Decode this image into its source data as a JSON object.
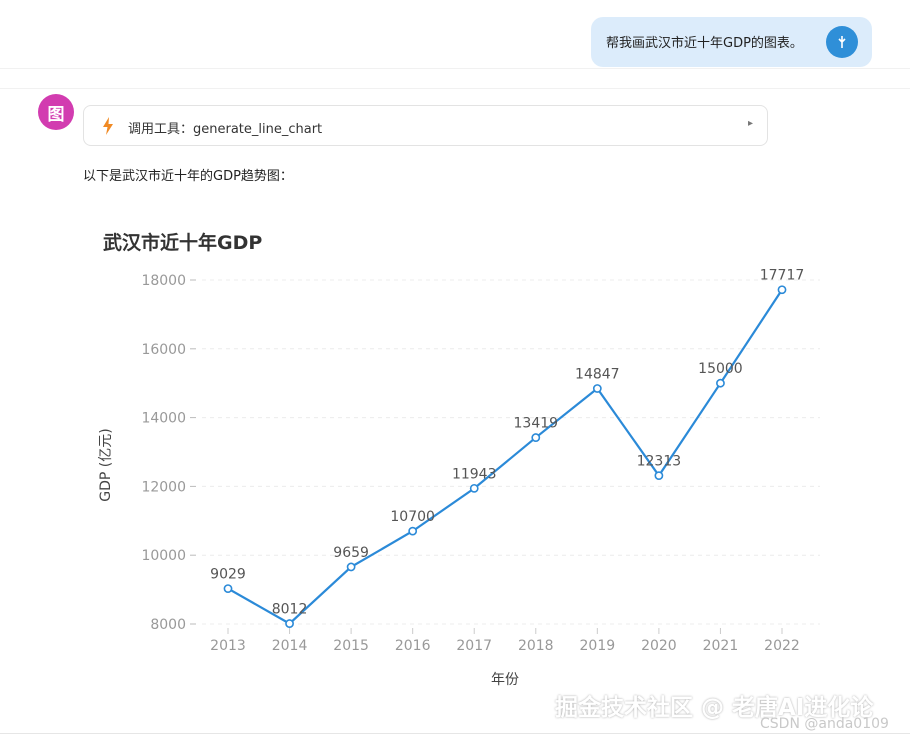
{
  "user_message": {
    "text": "帮我画武汉市近十年GDP的图表。"
  },
  "assistant": {
    "avatar_label": "图",
    "tool_call": {
      "label": "调用工具：generate_line_chart",
      "toggle": "▸"
    },
    "intro_text": "以下是武汉市近十年的GDP趋势图："
  },
  "chart_data": {
    "type": "line",
    "title": "武汉市近十年GDP",
    "xlabel": "年份",
    "ylabel": "GDP (亿元)",
    "x": [
      "2013",
      "2014",
      "2015",
      "2016",
      "2017",
      "2018",
      "2019",
      "2020",
      "2021",
      "2022"
    ],
    "series": [
      {
        "values": [
          9029,
          8012,
          9659,
          10700,
          11943,
          13419,
          14847,
          12313,
          15000,
          17717
        ]
      }
    ],
    "ylim": [
      8000,
      18000
    ],
    "yticks": [
      8000,
      10000,
      12000,
      14000,
      16000,
      18000
    ],
    "grid": true,
    "line_color": "#2b8ad8"
  },
  "watermark": {
    "text": "掘金技术社区 @ 老唐AI进化论",
    "sub": "CSDN @anda0109"
  }
}
